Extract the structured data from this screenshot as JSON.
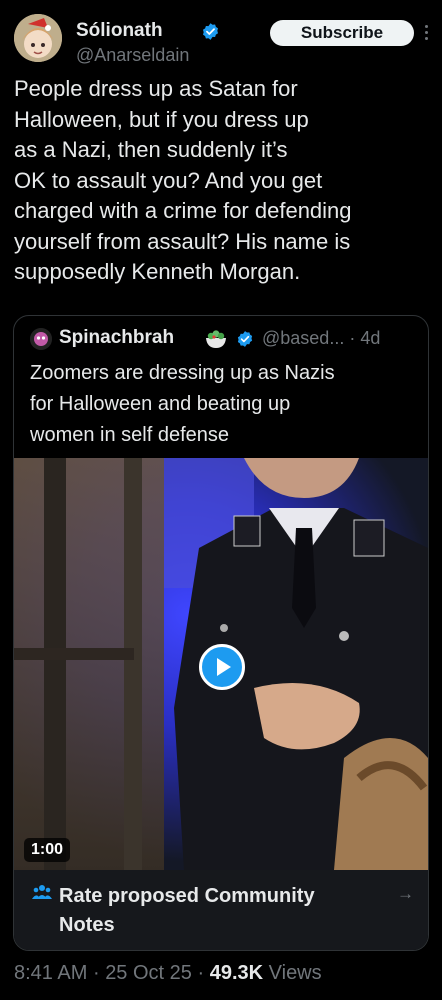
{
  "tweet": {
    "author_name": "Sólionath",
    "author_handle": "@Anarseldain",
    "subscribe_label": "Subscribe",
    "text": "People dress up as Satan for\nHalloween, but if you dress up\nas a Nazi, then suddenly it’s\nOK to assault you? And you get\ncharged with a crime for defending\nyourself from assault? His name is\nsupposedly Kenneth Morgan.",
    "verified": true
  },
  "quote": {
    "author_name": "Spinachbrah",
    "author_handle": "@based...",
    "time_sep": "·",
    "time": "4d",
    "text": "Zoomers are dressing up as Nazis\nfor Halloween and beating up\nwomen in self defense",
    "verified": true,
    "video": {
      "duration": "1:00"
    },
    "community_notes_label": "Rate proposed Community\nNotes"
  },
  "footer": {
    "time": "8:41 AM",
    "separator": "·",
    "date": "25 Oct 25",
    "views_count": "49.3K",
    "views_label": "Views"
  },
  "colors": {
    "background": "#000000",
    "text": "#e7e9ea",
    "muted": "#71767b",
    "accent": "#1d9bf0",
    "border": "#2f3336"
  }
}
